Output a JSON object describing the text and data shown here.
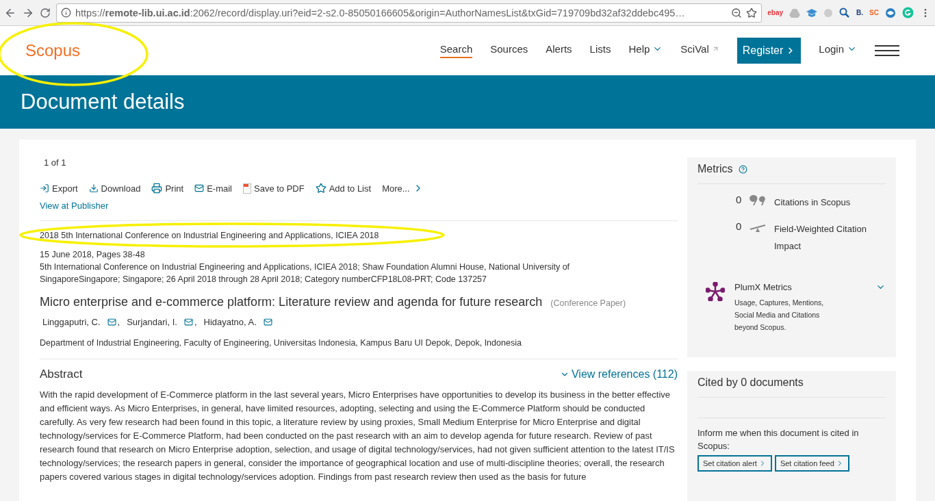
{
  "browser": {
    "url": "https://**remote-lib.ui.ac.id**:2062/record/display.uri?eid=2-s2.0-85050166605&origin=AuthorNamesList&txGid=719709bd32af32ddebc495…",
    "extensions": [
      {
        "kind": "text",
        "label": "ebay",
        "color": "#e53238"
      },
      {
        "kind": "drive"
      },
      {
        "kind": "cap"
      },
      {
        "kind": "circle"
      },
      {
        "kind": "magnifier"
      },
      {
        "kind": "text",
        "label": "B.",
        "color": "#1a3d7c"
      },
      {
        "kind": "text",
        "label": "SC",
        "color": "#f26522"
      },
      {
        "kind": "swirl"
      },
      {
        "kind": "grammarly"
      }
    ]
  },
  "header": {
    "logo": "Scopus",
    "logo_highlighted": true,
    "nav": [
      {
        "label": "Search",
        "selected": true,
        "kind": "plain"
      },
      {
        "label": "Sources",
        "selected": false,
        "kind": "plain"
      },
      {
        "label": "Alerts",
        "selected": false,
        "kind": "plain"
      },
      {
        "label": "Lists",
        "selected": false,
        "kind": "plain"
      },
      {
        "label": "Help",
        "selected": false,
        "kind": "dropdown"
      },
      {
        "label": "SciVal",
        "selected": false,
        "kind": "external"
      }
    ],
    "register": "Register",
    "login": "Login"
  },
  "banner": {
    "title": "Document details"
  },
  "document": {
    "pager": "1  of  1",
    "actions": [
      {
        "label": "Export",
        "kind": "export"
      },
      {
        "label": "Download",
        "kind": "download"
      },
      {
        "label": "Print",
        "kind": "print"
      },
      {
        "label": "E-mail",
        "kind": "mail"
      },
      {
        "label": "Save to PDF",
        "kind": "pdf"
      },
      {
        "label": "Add to List",
        "kind": "star"
      },
      {
        "label": "More...",
        "kind": "more"
      }
    ],
    "publisher_link": "View at Publisher",
    "source": "2018 5th International Conference on Industrial Engineering and Applications, ICIEA 2018",
    "source_highlighted": true,
    "date_pages": "15 June 2018, Pages 38-48",
    "conference": "5th International Conference on Industrial Engineering and Applications, ICIEA 2018; Shaw Foundation Alumni House, National University of SingaporeSingapore; Singapore; 26 April 2018 through 28 April 2018; Category numberCFP18L08-PRT; Code 137257",
    "title": "Micro enterprise and e-commerce platform: Literature review and agenda for future research",
    "doc_type": "(Conference Paper)",
    "authors": [
      {
        "name": "Linggaputri, C.",
        "sep": ","
      },
      {
        "name": "Surjandari, I.",
        "sep": ","
      },
      {
        "name": "Hidayatno, A."
      }
    ],
    "affiliation": "Department of Industrial Engineering, Faculty of Engineering, Universitas Indonesia, Kampus Baru UI Depok, Depok, Indonesia",
    "abstract_heading": "Abstract",
    "references_link": "View references (112)",
    "abstract": "With the rapid development of E-Commerce platform in the last several years, Micro Enterprises have opportunities to develop its business in the better effective and efficient ways. As Micro Enterprises, in general, have limited resources, adopting, selecting and using the E-Commerce Platform should be conducted carefully. As very few research had been found in this topic, a literature review by using proxies, Small Medium Enterprise for Micro Enterprise and digital technology/services for E-Commerce Platform, had been conducted on the past research with an aim to develop agenda for future research. Review of past research found that research on Micro Enterprise adoption, selection, and usage of digital technology/services, had not given sufficient attention to the latest IT/IS technology/services; the research papers in general, consider the importance of geographical location and use of multi-discipline theories; overall, the research papers covered various stages in digital technology/services adoption. Findings from past research review then used as the basis for future"
  },
  "metrics": {
    "title": "Metrics",
    "rows": [
      {
        "value": "0",
        "label": "Citations in Scopus",
        "kind": "quote"
      },
      {
        "value": "0",
        "label": "Field-Weighted Citation Impact",
        "kind": "scale"
      }
    ],
    "plumx": {
      "title": "PlumX Metrics",
      "text": "Usage, Captures, Mentions, Social Media and Citations beyond Scopus."
    }
  },
  "cited": {
    "title": "Cited by 0 documents",
    "inform": "Inform me when this document is cited in Scopus:",
    "buttons": [
      "Set citation alert",
      "Set citation feed"
    ]
  }
}
